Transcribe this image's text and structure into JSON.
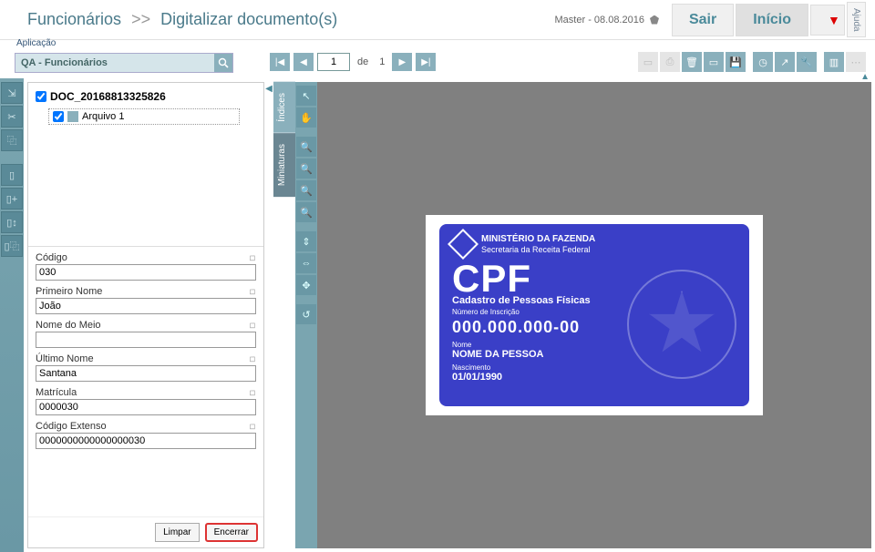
{
  "header": {
    "breadcrumb_main": "Funcionários",
    "breadcrumb_sep": ">>",
    "breadcrumb_sub": "Digitalizar documento(s)",
    "user": "Master - 08.08.2016",
    "sair": "Sair",
    "inicio": "Início",
    "ajuda": "Ajuda"
  },
  "toolbar": {
    "app_label": "Aplicação",
    "app_value": "QA - Funcionários",
    "page_current": "1",
    "page_de": "de",
    "page_total": "1"
  },
  "tree": {
    "root": "DOC_20168813325826",
    "child": "Arquivo 1"
  },
  "tabs": {
    "indices": "Índices",
    "miniaturas": "Miniaturas"
  },
  "fields": [
    {
      "label": "Código",
      "value": "030"
    },
    {
      "label": "Primeiro Nome",
      "value": "João"
    },
    {
      "label": "Nome do Meio",
      "value": ""
    },
    {
      "label": "Último Nome",
      "value": "Santana"
    },
    {
      "label": "Matrícula",
      "value": "0000030"
    },
    {
      "label": "Código Extenso",
      "value": "0000000000000000030"
    }
  ],
  "footer": {
    "limpar": "Limpar",
    "encerrar": "Encerrar"
  },
  "card": {
    "ministry": "MINISTÉRIO DA FAZENDA",
    "secretary": "Secretaria da Receita Federal",
    "title": "CPF",
    "subtitle": "Cadastro de Pessoas Físicas",
    "num_label": "Número de Inscrição",
    "number": "000.000.000-00",
    "nome_label": "Nome",
    "nome": "NOME DA PESSOA",
    "nasc_label": "Nascimento",
    "nasc": "01/01/1990"
  }
}
